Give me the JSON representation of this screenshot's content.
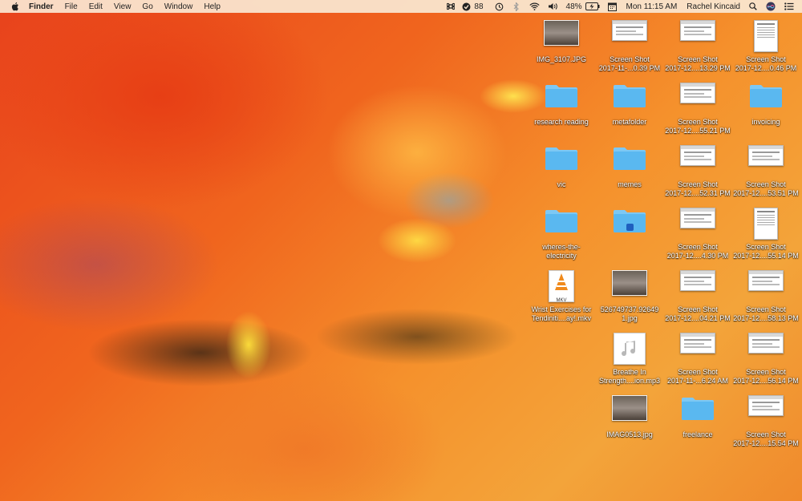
{
  "menubar": {
    "apple": "apple-icon",
    "app_name": "Finder",
    "menus": [
      "File",
      "Edit",
      "View",
      "Go",
      "Window",
      "Help"
    ],
    "status": {
      "notifications_count": "88",
      "battery_percent": "48%",
      "clock": "Mon 11:15 AM",
      "user": "Rachel Kincaid"
    }
  },
  "desktop": {
    "icons": [
      {
        "name": "IMG_3107.JPG",
        "line2": "",
        "kind": "photo"
      },
      {
        "name": "Screen Shot",
        "line2": "2017-11-...0.39 PM",
        "kind": "shot-wide"
      },
      {
        "name": "Screen Shot",
        "line2": "2017-12....13.29 PM",
        "kind": "shot-wide"
      },
      {
        "name": "Screen Shot",
        "line2": "2017-12....0.46 PM",
        "kind": "shot-tall"
      },
      {
        "name": "research reading",
        "line2": "",
        "kind": "folder"
      },
      {
        "name": "metafolder",
        "line2": "",
        "kind": "folder"
      },
      {
        "name": "Screen Shot",
        "line2": "2017-12....55.21 PM",
        "kind": "shot-wide"
      },
      {
        "name": "invoicing",
        "line2": "",
        "kind": "folder"
      },
      {
        "name": "vic",
        "line2": "",
        "kind": "folder"
      },
      {
        "name": "memes",
        "line2": "",
        "kind": "folder"
      },
      {
        "name": "Screen Shot",
        "line2": "2017-12....52.31 PM",
        "kind": "shot-wide"
      },
      {
        "name": "Screen Shot",
        "line2": "2017-12....53.51 PM",
        "kind": "shot-wide"
      },
      {
        "name": "wheres-the-",
        "line2": "electricity",
        "kind": "folder"
      },
      {
        "name": "",
        "line2": "",
        "kind": "folder-alias"
      },
      {
        "name": "Screen Shot",
        "line2": "2017-12....4.30 PM",
        "kind": "shot-wide"
      },
      {
        "name": "Screen Shot",
        "line2": "2017-12....55.14 PM",
        "kind": "shot-tall"
      },
      {
        "name": "Wrist Exercises for",
        "line2": "Tendiniti....ay!.mkv",
        "kind": "mkv"
      },
      {
        "name": "526749737.92649",
        "line2": "1.jpg",
        "kind": "photo"
      },
      {
        "name": "Screen Shot",
        "line2": "2017-12....04.21 PM",
        "kind": "shot-wide"
      },
      {
        "name": "Screen Shot",
        "line2": "2017-12....58.13 PM",
        "kind": "shot-wide"
      },
      {
        "name": "Breathe In",
        "line2": "Strength....ion.mp3",
        "kind": "mp3"
      },
      {
        "name": "Screen Shot",
        "line2": "2017-11-...6.24 AM",
        "kind": "shot-wide"
      },
      {
        "name": "Screen Shot",
        "line2": "2017-12....56.14 PM",
        "kind": "shot-wide"
      },
      {
        "name": "IMAG0513.jpg",
        "line2": "",
        "kind": "photo"
      },
      {
        "name": "freelance",
        "line2": "",
        "kind": "folder"
      },
      {
        "name": "Screen Shot",
        "line2": "2017-12....15.54 PM",
        "kind": "shot-wide"
      }
    ],
    "mkv_badge": "MKV"
  },
  "colors": {
    "folder": "#5ab8f0",
    "folder_tab": "#7dc8f4",
    "menubar_bg": "#fae8d2"
  }
}
